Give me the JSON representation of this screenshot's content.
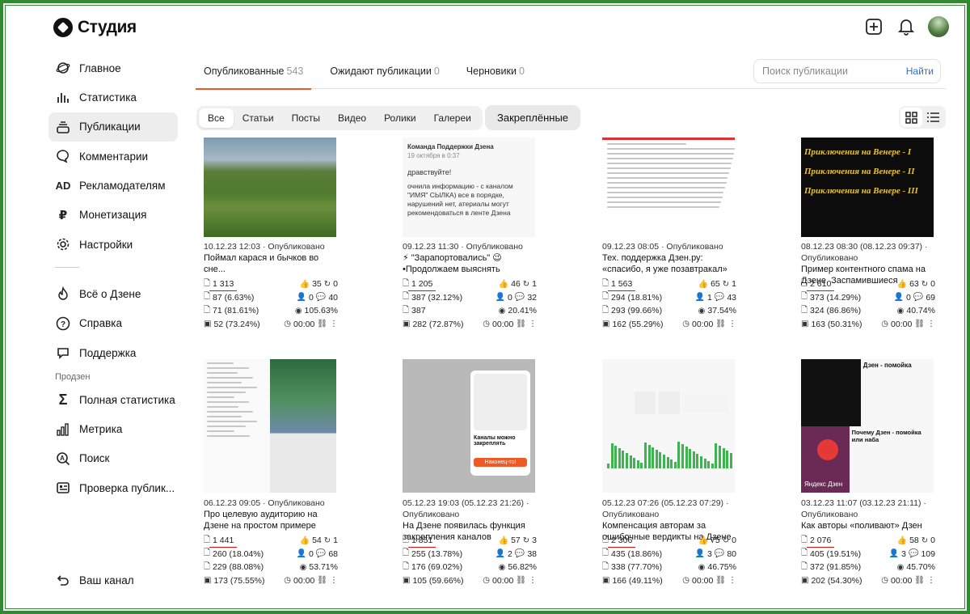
{
  "app": {
    "title": "Студия"
  },
  "sidebar": {
    "items": [
      {
        "label": "Главное",
        "icon": "orbit-icon"
      },
      {
        "label": "Статистика",
        "icon": "bar-chart-icon"
      },
      {
        "label": "Публикации",
        "icon": "stack-icon"
      },
      {
        "label": "Комментарии",
        "icon": "comment-icon"
      },
      {
        "label": "Рекламодателям",
        "icon": "ad-icon"
      },
      {
        "label": "Монетизация",
        "icon": "ruble-icon"
      },
      {
        "label": "Настройки",
        "icon": "gear-icon"
      }
    ],
    "help_items": [
      {
        "label": "Всё о Дзене",
        "icon": "flame-icon"
      },
      {
        "label": "Справка",
        "icon": "question-icon"
      },
      {
        "label": "Поддержка",
        "icon": "chat-icon"
      }
    ],
    "section_title": "Продзен",
    "prodzen_items": [
      {
        "label": "Полная статистика",
        "icon": "sigma-icon"
      },
      {
        "label": "Метрика",
        "icon": "metric-icon"
      },
      {
        "label": "Поиск",
        "icon": "search-a-icon"
      },
      {
        "label": "Проверка публик...",
        "icon": "check-pub-icon"
      }
    ],
    "your_channel": "Ваш канал"
  },
  "tabs": [
    {
      "label": "Опубликованные",
      "count": "543"
    },
    {
      "label": "Ожидают публикации",
      "count": "0"
    },
    {
      "label": "Черновики",
      "count": "0"
    }
  ],
  "search": {
    "placeholder": "Поиск публикации",
    "button": "Найти"
  },
  "filters": [
    "Все",
    "Статьи",
    "Посты",
    "Видео",
    "Ролики",
    "Галереи"
  ],
  "pinned": "Закреплённые",
  "thumb_texts": {
    "post_author": "Команда Поддержки Дзена",
    "post_date": "19 октября в 0:37",
    "post_greeting": "дравствуйте!",
    "post_body": "очнила информацию - с каналом \"ИМЯ\" СЫЛКА) все в порядке, нарушений нет, атериалы могут рекомендоваться в ленте Дзена",
    "venus": [
      "Приключения на Венере - I",
      "Приключения на Венере - II",
      "Приключения на Венере - III"
    ],
    "pin_popup_title": "Каналы можно закреплять",
    "pin_popup_button": "Наконец-то!",
    "dzen_title": "Дзен - помойка",
    "dzen_logo": "Яндекс Дзен",
    "dzen_sub": "Почему Дзен - помойка или наба"
  },
  "cards": [
    {
      "meta": "10.12.23 12:03 · Опубликовано",
      "title": "Поймал карася и бычков во сне...",
      "views": "1 313",
      "likes": "35",
      "reposts": "0",
      "s2": "87 (6.63%)",
      "s2r": "0",
      "s2c": "40",
      "s3": "71 (81.61%)",
      "s3r": "105.63%",
      "s4": "52 (73.24%)",
      "time": "00:00"
    },
    {
      "meta": "09.12.23 11:30 · Опубликовано",
      "title": "⚡ \"Зарапортовались\" 😉 •Продолжаем выяснять пикантные подроб...",
      "views": "1 205",
      "likes": "46",
      "reposts": "1",
      "s2": "387 (32.12%)",
      "s2r": "0",
      "s2c": "32",
      "s3": "387",
      "s3r": "20.41%",
      "s4": "282 (72.87%)",
      "time": "00:00"
    },
    {
      "meta": "09.12.23 08:05 · Опубликовано",
      "title": "Тех. поддержка Дзен.ру: «спасибо, я уже позавтракал»",
      "views": "1 563",
      "likes": "65",
      "reposts": "1",
      "s2": "294 (18.81%)",
      "s2r": "1",
      "s2c": "43",
      "s3": "293 (99.66%)",
      "s3r": "37.54%",
      "s4": "162 (55.29%)",
      "time": "00:00"
    },
    {
      "meta": "08.12.23 08:30 (08.12.23 09:37) · Опубликовано",
      "title": "Пример контентного спама на Дзене. Заспамившиеся заголовки",
      "views": "2 610",
      "likes": "63",
      "reposts": "0",
      "s2": "373 (14.29%)",
      "s2r": "0",
      "s2c": "69",
      "s3": "324 (86.86%)",
      "s3r": "40.74%",
      "s4": "163 (50.31%)",
      "time": "00:00"
    },
    {
      "meta": "06.12.23 09:05 · Опубликовано",
      "title": "Про целевую аудиторию на Дзене на простом примере",
      "views": "1 441",
      "likes": "54",
      "reposts": "1",
      "s2": "260 (18.04%)",
      "s2r": "0",
      "s2c": "68",
      "s3": "229 (88.08%)",
      "s3r": "53.71%",
      "s4": "173 (75.55%)",
      "time": "00:00"
    },
    {
      "meta": "05.12.23 19:03 (05.12.23 21:26) · Опубликовано",
      "title": "На Дзене появилась функция закрепления каналов",
      "views": "1 851",
      "likes": "57",
      "reposts": "3",
      "s2": "255 (13.78%)",
      "s2r": "2",
      "s2c": "38",
      "s3": "176 (69.02%)",
      "s3r": "56.82%",
      "s4": "105 (59.66%)",
      "time": "00:00"
    },
    {
      "meta": "05.12.23 07:26 (05.12.23 07:29) · Опубликовано",
      "title": "Компенсация авторам за ошибочные вердикты на Дзене",
      "views": "2 306",
      "likes": "75",
      "reposts": "0",
      "s2": "435 (18.86%)",
      "s2r": "3",
      "s2c": "80",
      "s3": "338 (77.70%)",
      "s3r": "46.75%",
      "s4": "166 (49.11%)",
      "time": "00:00"
    },
    {
      "meta": "03.12.23 11:07 (03.12.23 21:11) · Опубликовано",
      "title": "Как авторы «поливают» Дзен",
      "views": "2 076",
      "likes": "58",
      "reposts": "0",
      "s2": "405 (19.51%)",
      "s2r": "3",
      "s2c": "109",
      "s3": "372 (91.85%)",
      "s3r": "45.70%",
      "s4": "202 (54.30%)",
      "time": "00:00"
    }
  ]
}
